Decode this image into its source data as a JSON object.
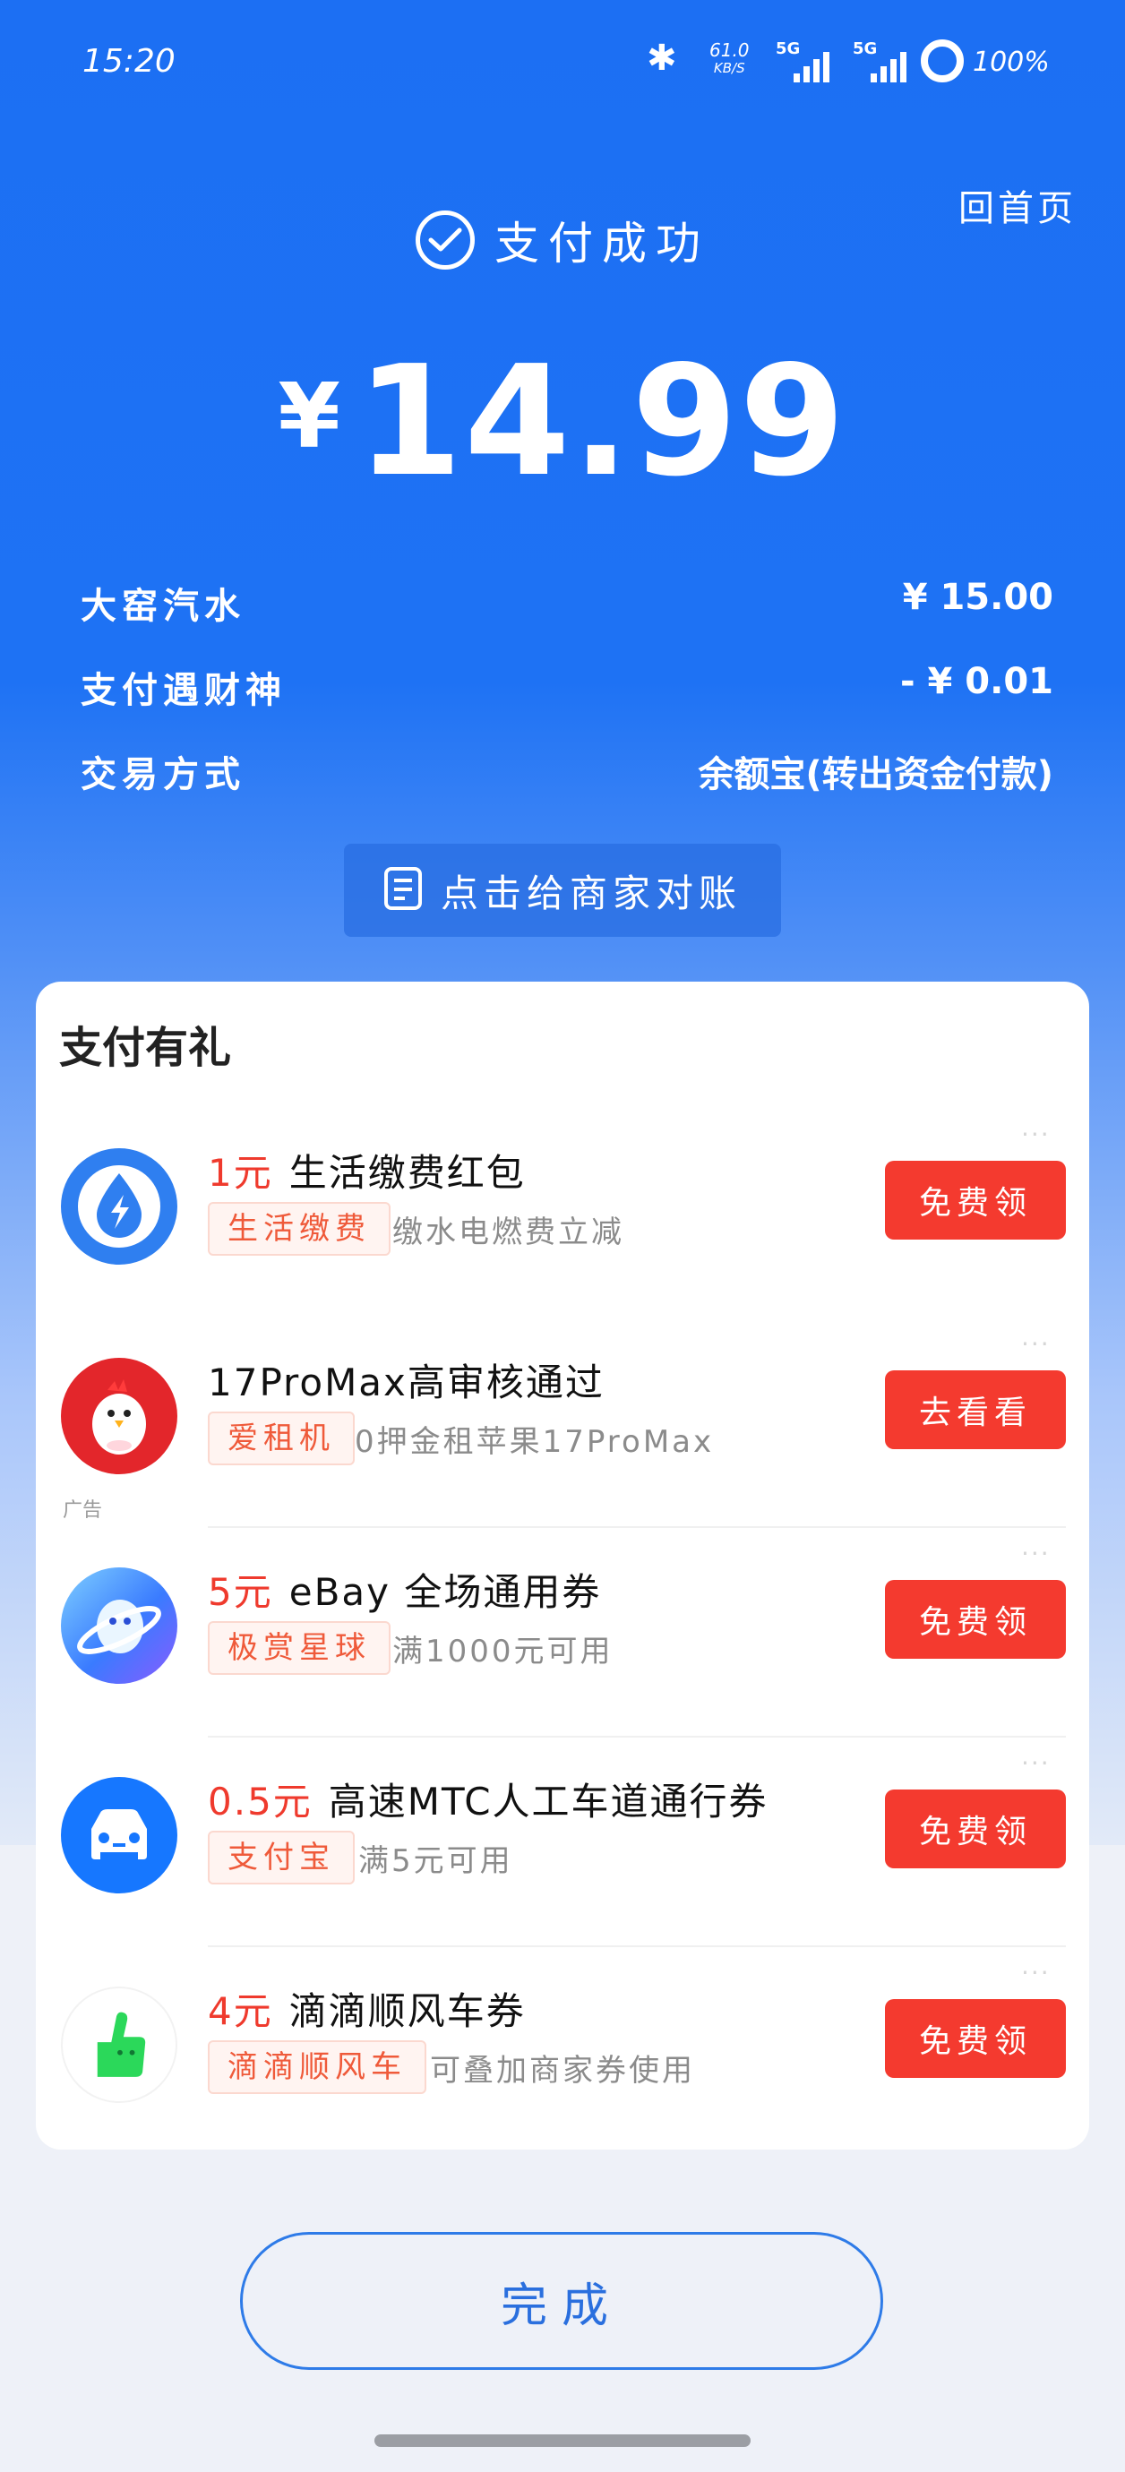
{
  "status_bar": {
    "time": "15:20",
    "net_speed": "61.0",
    "net_unit": "KB/S",
    "sig1_label": "5G",
    "sig2_label": "5G",
    "battery": "100%"
  },
  "header": {
    "home_link": "回首页",
    "success_text": "支付成功",
    "currency": "¥",
    "amount": "14.99"
  },
  "details": [
    {
      "label": "大窑汽水",
      "value": "¥ 15.00"
    },
    {
      "label": "支付遇财神",
      "value": "- ¥ 0.01"
    },
    {
      "label": "交易方式",
      "value": "余额宝(转出资金付款)"
    }
  ],
  "reconcile_button": "点击给商家对账",
  "rewards": {
    "title": "支付有礼",
    "more": "···",
    "ad_label": "广告",
    "offers": [
      {
        "price": "1元",
        "title": "生活缴费红包",
        "tag": "生活缴费",
        "desc": "缴水电燃费立减",
        "button": "免费领",
        "icon": "lightning-icon"
      },
      {
        "price": "",
        "title": "17ProMax高审核通过",
        "tag": "爱租机",
        "desc": "0押金租苹果17ProMax",
        "button": "去看看",
        "icon": "chick-mascot-icon"
      },
      {
        "price": "5元",
        "title": "eBay 全场通用券",
        "tag": "极赏星球",
        "desc": "满1000元可用",
        "button": "免费领",
        "icon": "planet-icon"
      },
      {
        "price": "0.5元",
        "title": "高速MTC人工车道通行券",
        "tag": "支付宝",
        "desc": "满5元可用",
        "button": "免费领",
        "icon": "car-icon"
      },
      {
        "price": "4元",
        "title": "滴滴顺风车券",
        "tag": "滴滴顺风车",
        "desc": "可叠加商家券使用",
        "button": "免费领",
        "icon": "thumbs-up-icon"
      }
    ]
  },
  "done_button": "完成",
  "colors": {
    "brand_blue": "#1c6ff3",
    "accent_red": "#f43a2f",
    "tag_orange": "#ef5a3a"
  }
}
